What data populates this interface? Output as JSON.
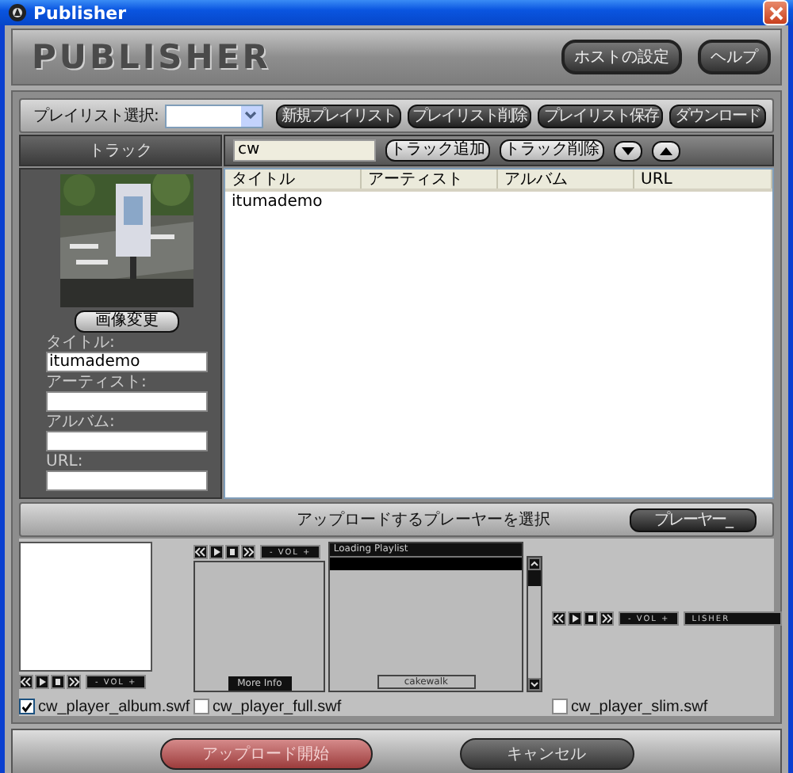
{
  "window": {
    "title": "Publisher"
  },
  "header": {
    "logo": "PUBLISHER",
    "buttons": [
      "ホストの設定",
      "ヘルプ"
    ]
  },
  "playlist": {
    "label": "プレイリスト選択:",
    "buttons": [
      "新規プレイリスト",
      "プレイリスト削除",
      "プレイリスト保存",
      "ダウンロード"
    ]
  },
  "tracks": {
    "title": "トラック",
    "search": "cw",
    "buttons": [
      "トラック追加",
      "トラック削除"
    ]
  },
  "editor": {
    "change_image": "画像変更",
    "fields": [
      {
        "label": "タイトル:",
        "value": "itumademo"
      },
      {
        "label": "アーティスト:"
      },
      {
        "label": "アルバム:"
      },
      {
        "label": "URL:"
      }
    ]
  },
  "table": {
    "columns": [
      "タイトル",
      "アーティスト",
      "アルバム",
      "URL"
    ],
    "rows": [
      [
        "itumademo"
      ]
    ]
  },
  "players": {
    "title": "アップロードするプレーヤーを選択",
    "button": "プレーヤー_",
    "items": [
      {
        "kind": "album",
        "file": "cw_player_album.swf",
        "checked": true,
        "vol": "- VOL +"
      },
      {
        "kind": "full",
        "file": "cw_player_full.swf",
        "checked": false,
        "vol": "- VOL +",
        "more": "More Info",
        "playlist": "Loading Playlist",
        "track": "cakewalk"
      },
      {
        "kind": "slim",
        "file": "cw_player_slim.swf",
        "checked": false,
        "vol": "- VOL +",
        "display": "LISHER"
      }
    ]
  },
  "footer": {
    "buttons": [
      {
        "label": "アップロード開始",
        "kind": "primary"
      },
      {
        "label": "キャンセル",
        "kind": "normal"
      }
    ]
  }
}
